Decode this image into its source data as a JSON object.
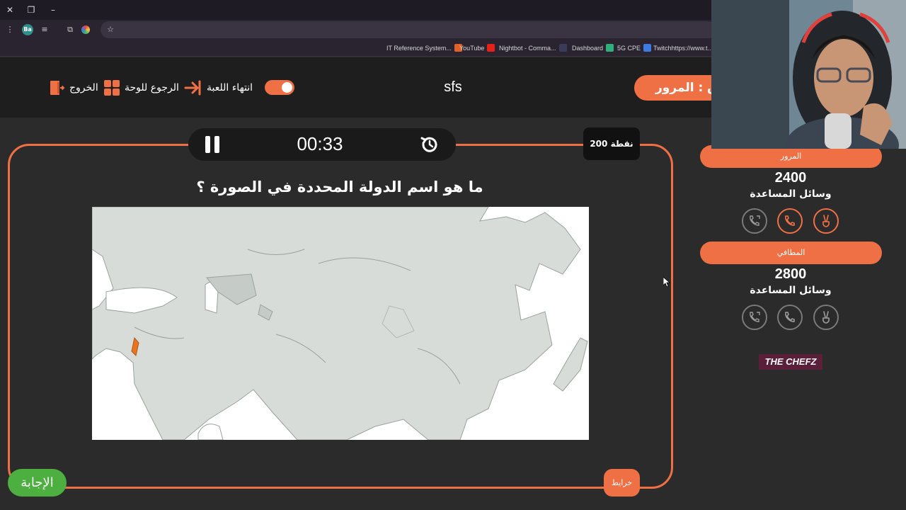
{
  "browser": {
    "bookmarks": [
      {
        "label": "IT Reference System...",
        "color": "#e0622b"
      },
      {
        "label": "YouTube",
        "color": "#e62117"
      },
      {
        "label": "Nightbot - Comma...",
        "color": "#3a3a5a"
      },
      {
        "label": "Dashboard",
        "color": "#2fb07a"
      },
      {
        "label": "5G CPE",
        "color": "#3d7be0"
      },
      {
        "label": "Twitchhttps://www.t...",
        "color": "#9146ff"
      }
    ],
    "extension_badge": "Ba"
  },
  "header": {
    "exit_label": "الخروج",
    "back_label": "الرجوع للوحة",
    "end_game_label": "انتهاء اللعبة",
    "game_title": "sfs",
    "current_team": "ق : المرور"
  },
  "question_panel": {
    "timer": "00:33",
    "points": "200 نقطة",
    "question": "ما هو اسم الدولة المحددة في الصورة ؟",
    "category": "خرايط",
    "answer_button": "الإجابة"
  },
  "teams": [
    {
      "name": "المرور",
      "score": "2400",
      "helpers_label": "وسائل المساعدة",
      "helpers": [
        "swap-call",
        "phone",
        "two-answers"
      ]
    },
    {
      "name": "المطافي",
      "score": "2800",
      "helpers_label": "وسائل المساعدة",
      "helpers": [
        "swap-call",
        "phone",
        "two-answers"
      ]
    }
  ],
  "logo_text": "THE CHEFZ",
  "colors": {
    "accent": "#f07045",
    "answer": "#4caf3f",
    "background": "#2b2b2b",
    "highlight_country": "#e8741f"
  }
}
